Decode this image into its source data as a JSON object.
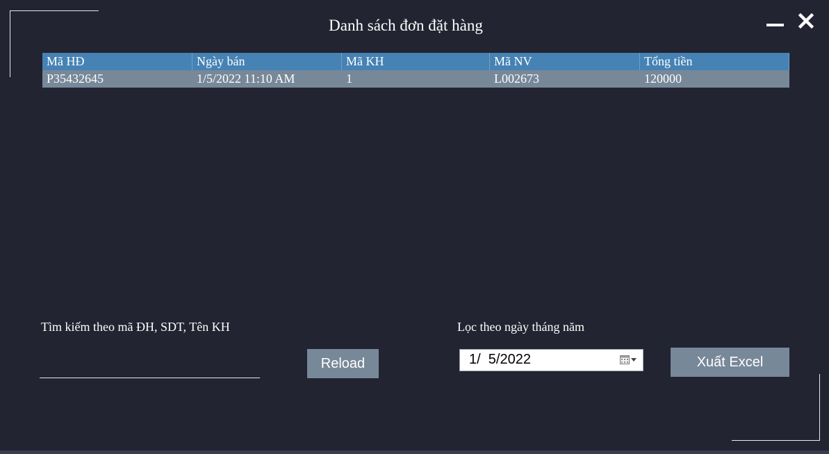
{
  "window": {
    "title": "Danh sách đơn đặt hàng",
    "minimize_icon": "minimize-icon",
    "close_icon": "close-icon"
  },
  "orders_table": {
    "columns": [
      "Mã HĐ",
      "Ngày bán",
      "Mã KH",
      "Mã NV",
      "Tổng tiền"
    ],
    "rows": [
      [
        "P35432645",
        "1/5/2022 11:10 AM",
        "1",
        "L002673",
        "120000"
      ]
    ],
    "header_color": "#4682b4",
    "row_color": "#778899"
  },
  "search": {
    "label": "Tìm kiếm theo mã ĐH, SDT, Tên KH",
    "value": ""
  },
  "reload_button": {
    "label": "Reload"
  },
  "date_filter": {
    "label": "Lọc theo ngày tháng năm",
    "value": "1/  5/2022",
    "icon": "calendar-icon"
  },
  "export_button": {
    "label": "Xuất Excel"
  },
  "colors": {
    "background": "#222431",
    "button": "#778899",
    "text": "#ffffff"
  }
}
